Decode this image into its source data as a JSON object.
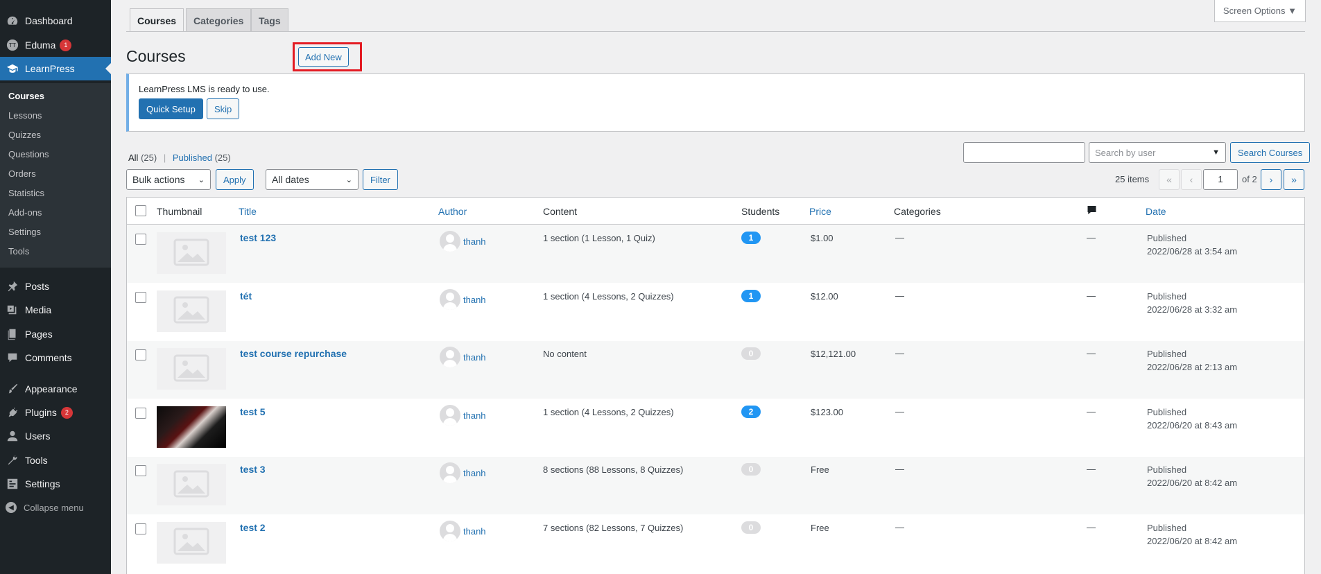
{
  "sidebar": {
    "top_items": [
      {
        "label": "Dashboard",
        "icon": "dashboard-icon"
      },
      {
        "label": "Eduma",
        "icon": "eduma-icon",
        "badge": "1"
      },
      {
        "label": "LearnPress",
        "icon": "graduation-cap-icon"
      }
    ],
    "submenu": [
      "Courses",
      "Lessons",
      "Quizzes",
      "Questions",
      "Orders",
      "Statistics",
      "Add-ons",
      "Settings",
      "Tools"
    ],
    "items": [
      {
        "label": "Posts",
        "icon": "pin-icon"
      },
      {
        "label": "Media",
        "icon": "media-icon"
      },
      {
        "label": "Pages",
        "icon": "pages-icon"
      },
      {
        "label": "Comments",
        "icon": "comment-icon"
      },
      {
        "label": "Appearance",
        "icon": "brush-icon"
      },
      {
        "label": "Plugins",
        "icon": "plugin-icon",
        "badge": "2"
      },
      {
        "label": "Users",
        "icon": "user-icon"
      },
      {
        "label": "Tools",
        "icon": "wrench-icon"
      },
      {
        "label": "Settings",
        "icon": "settings-icon"
      }
    ],
    "collapse_label": "Collapse menu",
    "accent": "#2271b1",
    "badge_color": "#d63638"
  },
  "tabs": [
    "Courses",
    "Categories",
    "Tags"
  ],
  "screen_options": "Screen Options ▼",
  "page_title": "Courses",
  "add_new": "Add New",
  "notice": {
    "text": "LearnPress LMS is ready to use.",
    "primary": "Quick Setup",
    "secondary": "Skip"
  },
  "views": {
    "all_label": "All",
    "all_count": "(25)",
    "published_label": "Published",
    "published_count": "(25)"
  },
  "search": {
    "input_value": "",
    "user_placeholder": "Search by user",
    "button": "Search Courses"
  },
  "filters": {
    "bulk_actions": "Bulk actions",
    "apply": "Apply",
    "dates": "All dates",
    "filter": "Filter"
  },
  "pagination": {
    "items": "25 items",
    "first": "«",
    "prev": "‹",
    "current": "1",
    "of": "of 2",
    "next": "›",
    "last": "»"
  },
  "table": {
    "headers": {
      "thumbnail": "Thumbnail",
      "title": "Title",
      "author": "Author",
      "content": "Content",
      "students": "Students",
      "price": "Price",
      "categories": "Categories",
      "comments_icon": "comment-bubble-icon",
      "date": "Date"
    },
    "rows": [
      {
        "title": "test 123",
        "author": "thanh",
        "content": "1 section (1 Lesson, 1 Quiz)",
        "students": "1",
        "price": "$1.00",
        "categories": "—",
        "comments": "—",
        "status": "Published",
        "date": "2022/06/28 at 3:54 am"
      },
      {
        "title": "tét",
        "author": "thanh",
        "content": "1 section (4 Lessons, 2 Quizzes)",
        "students": "1",
        "price": "$12.00",
        "categories": "—",
        "comments": "—",
        "status": "Published",
        "date": "2022/06/28 at 3:32 am"
      },
      {
        "title": "test course repurchase",
        "author": "thanh",
        "content": "No content",
        "students": "0",
        "price": "$12,121.00",
        "categories": "—",
        "comments": "—",
        "status": "Published",
        "date": "2022/06/28 at 2:13 am"
      },
      {
        "title": "test 5",
        "author": "thanh",
        "content": "1 section (4 Lessons, 2 Quizzes)",
        "students": "2",
        "price": "$123.00",
        "categories": "—",
        "comments": "—",
        "status": "Published",
        "date": "2022/06/20 at 8:43 am"
      },
      {
        "title": "test 3",
        "author": "thanh",
        "content": "8 sections (88 Lessons, 8 Quizzes)",
        "students": "0",
        "price": "Free",
        "categories": "—",
        "comments": "—",
        "status": "Published",
        "date": "2022/06/20 at 8:42 am"
      },
      {
        "title": "test 2",
        "author": "thanh",
        "content": "7 sections (82 Lessons, 7 Quizzes)",
        "students": "0",
        "price": "Free",
        "categories": "—",
        "comments": "—",
        "status": "Published",
        "date": "2022/06/20 at 8:42 am"
      }
    ],
    "student_badge_active": "#2196f3",
    "student_badge_zero": "#dcdcde"
  },
  "highlight_color": "#e31b23"
}
